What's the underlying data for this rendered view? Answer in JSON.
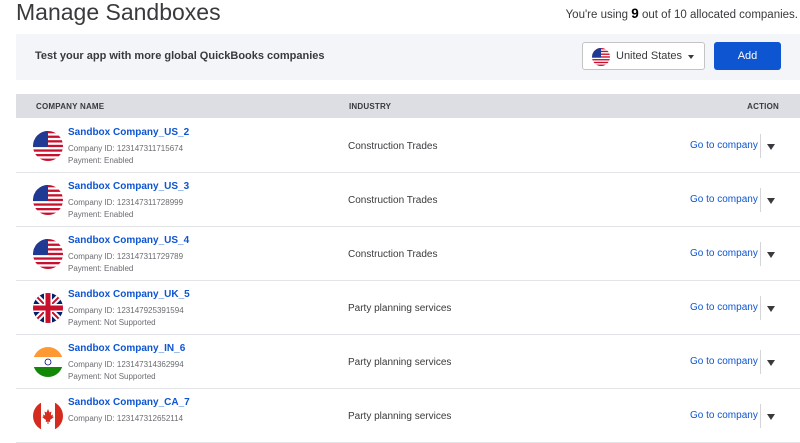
{
  "page": {
    "title": "Manage Sandboxes"
  },
  "usage": {
    "prefix": "You're using",
    "used": "9",
    "suffix": "out of 10 allocated companies."
  },
  "banner": {
    "text": "Test your app with more global QuickBooks companies",
    "country_selected": "United States",
    "add_label": "Add"
  },
  "table": {
    "headers": {
      "company": "COMPANY NAME",
      "industry": "INDUSTRY",
      "action": "ACTION"
    },
    "rows": [
      {
        "name": "Sandbox Company_US_2",
        "company_id": "Company ID: 123147311715674",
        "payment": "Payment: Enabled",
        "industry": "Construction Trades",
        "action": "Go to company",
        "flag": "us-flag-icon"
      },
      {
        "name": "Sandbox Company_US_3",
        "company_id": "Company ID: 123147311728999",
        "payment": "Payment: Enabled",
        "industry": "Construction Trades",
        "action": "Go to company",
        "flag": "us-flag-icon"
      },
      {
        "name": "Sandbox Company_US_4",
        "company_id": "Company ID: 123147311729789",
        "payment": "Payment: Enabled",
        "industry": "Construction Trades",
        "action": "Go to company",
        "flag": "us-flag-icon"
      },
      {
        "name": "Sandbox Company_UK_5",
        "company_id": "Company ID: 123147925391594",
        "payment": "Payment: Not Supported",
        "industry": "Party planning services",
        "action": "Go to company",
        "flag": "uk-flag-icon"
      },
      {
        "name": "Sandbox Company_IN_6",
        "company_id": "Company ID: 123147314362994",
        "payment": "Payment: Not Supported",
        "industry": "Party planning services",
        "action": "Go to company",
        "flag": "india-flag-icon"
      },
      {
        "name": "Sandbox Company_CA_7",
        "company_id": "Company ID: 123147312652114",
        "payment": "",
        "industry": "Party planning services",
        "action": "Go to company",
        "flag": "canada-flag-icon"
      }
    ]
  },
  "colors": {
    "link": "#0d55d1",
    "add_button": "#0d55d1",
    "header_bg": "#dcdee3",
    "banner_bg": "#f4f5f8"
  }
}
